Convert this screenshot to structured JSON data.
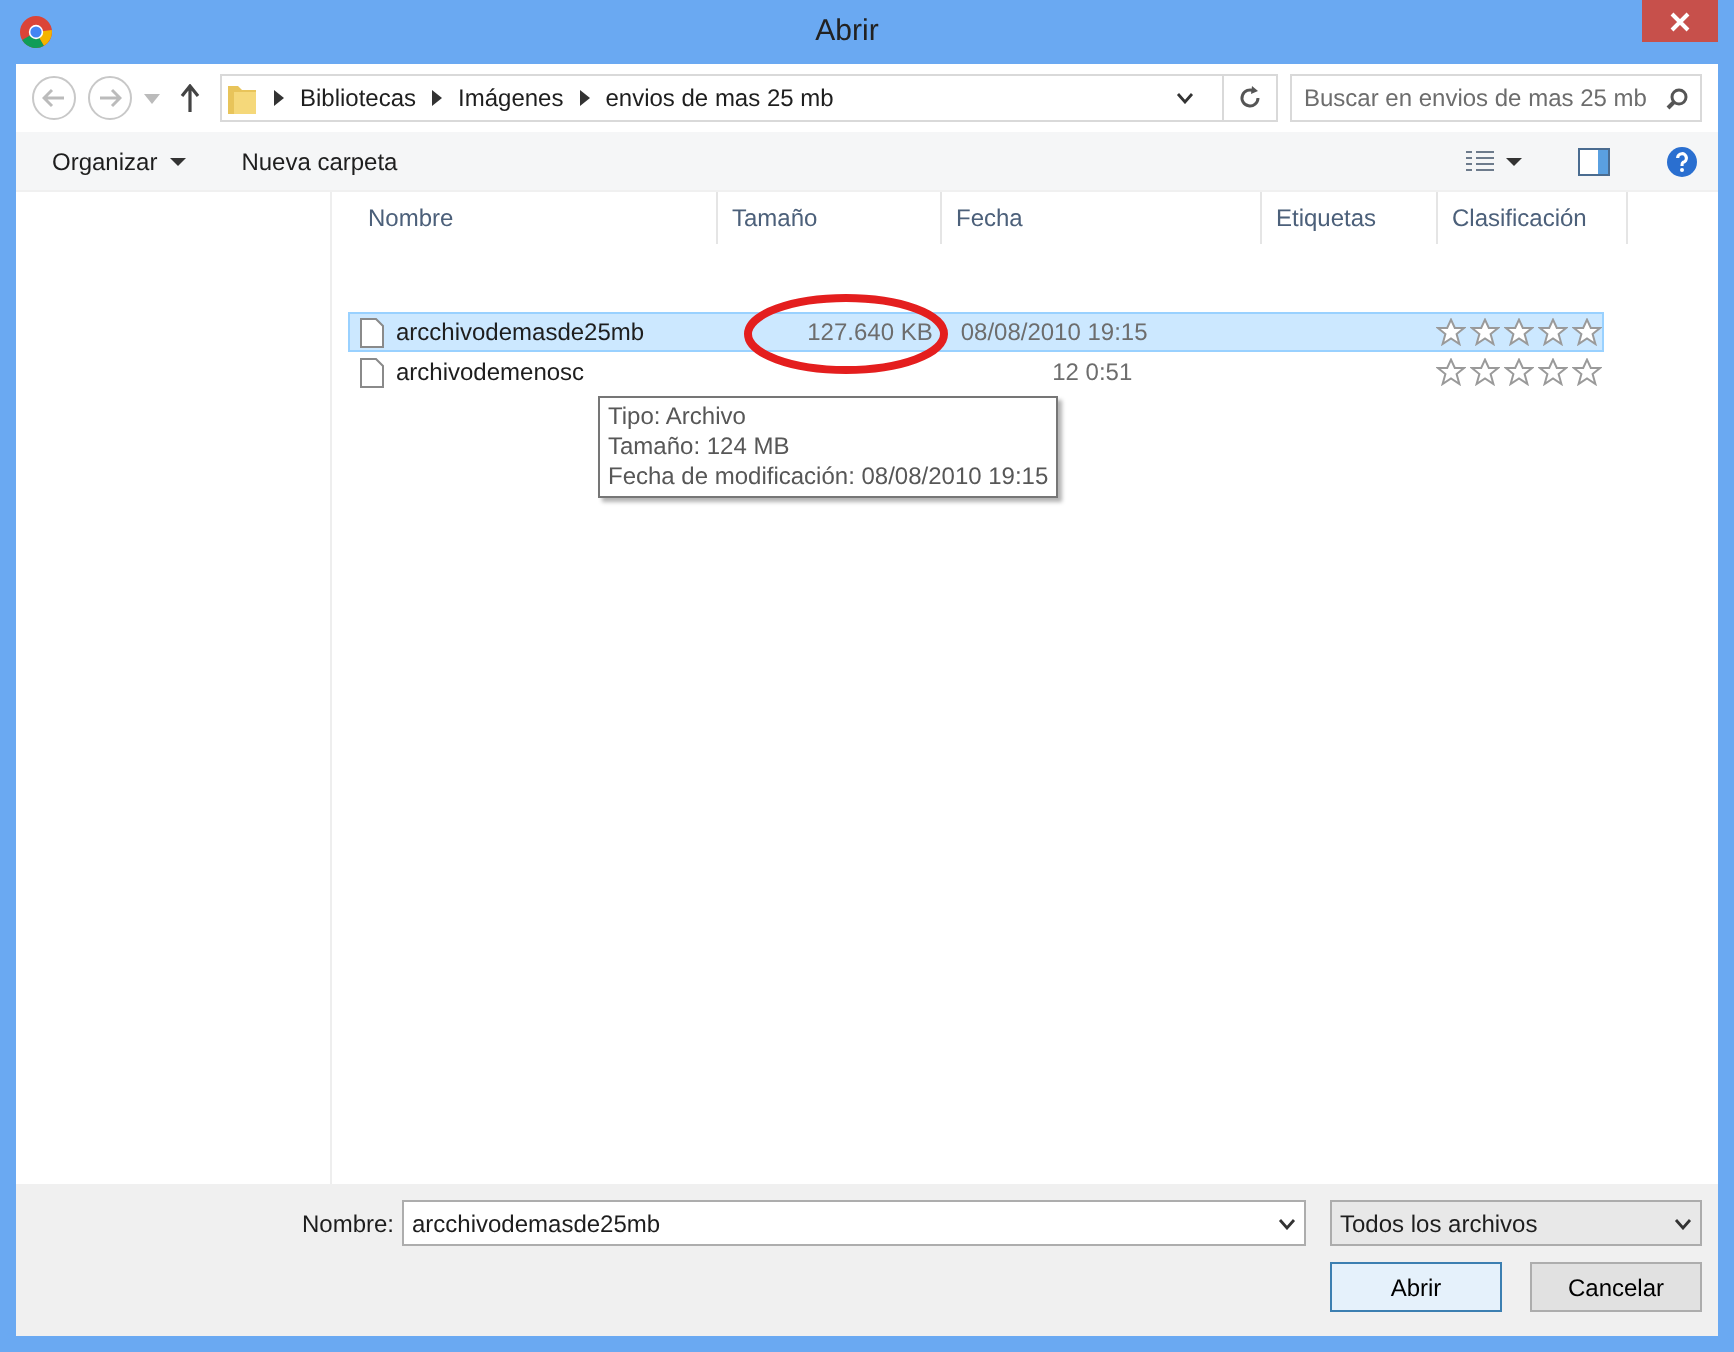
{
  "window": {
    "title": "Abrir"
  },
  "address": {
    "path": [
      "Bibliotecas",
      "Imágenes",
      "envios de mas 25 mb"
    ]
  },
  "search": {
    "placeholder": "Buscar en envios de mas 25 mb"
  },
  "toolbar": {
    "organize": "Organizar",
    "new_folder": "Nueva carpeta"
  },
  "columns": [
    "Nombre",
    "Tamaño",
    "Fecha",
    "Etiquetas",
    "Clasificación"
  ],
  "files": [
    {
      "name": "arcchivodemasde25mb",
      "size": "127.640 KB",
      "date": "08/08/2010 19:15",
      "stars": 0,
      "selected": true
    },
    {
      "name": "archivodemenosc",
      "date": "12 0:51",
      "stars": 0,
      "selected": false
    }
  ],
  "tooltip": [
    "Tipo: Archivo",
    "Tamaño: 124 MB",
    "Fecha de modificación: 08/08/2010 19:15"
  ],
  "filename": {
    "label": "Nombre:",
    "value": "arcchivodemasde25mb"
  },
  "filetype": {
    "value": "Todos los archivos"
  },
  "buttons": [
    "Abrir",
    "Cancelar"
  ]
}
